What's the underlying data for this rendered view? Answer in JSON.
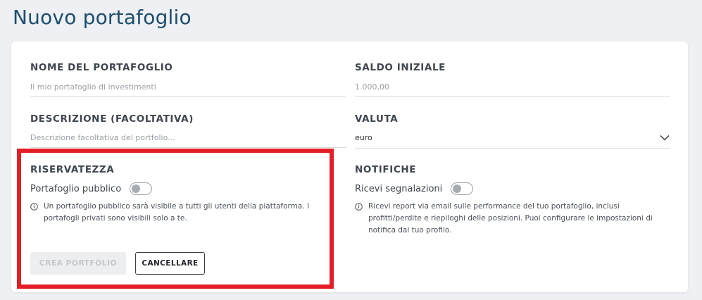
{
  "page": {
    "title": "Nuovo portafoglio"
  },
  "form": {
    "name": {
      "label": "NOME DEL PORTAFOGLIO",
      "placeholder": "Il mio portafoglio di investimenti"
    },
    "balance": {
      "label": "SALDO INIZIALE",
      "placeholder": "1.000,00"
    },
    "description": {
      "label": "DESCRIZIONE (FACOLTATIVA)",
      "placeholder": "Descrizione facoltativa del portfolio..."
    },
    "currency": {
      "label": "VALUTA",
      "value": "euro",
      "icon": "chevron-down-icon"
    },
    "privacy": {
      "label": "RISERVATEZZA",
      "toggle_label": "Portafoglio pubblico",
      "toggle_on": false,
      "help": "Un portafoglio pubblico sarà visibile a tutti gli utenti della piattaforma. I portafogli privati sono visibili solo a te."
    },
    "notifications": {
      "label": "NOTIFICHE",
      "toggle_label": "Ricevi segnalazioni",
      "toggle_on": false,
      "help": "Ricevi report via email sulle performance del tuo portafoglio, inclusi profitti/perdite e riepiloghi delle posizioni. Puoi configurare le impostazioni di notifica dal tuo profilo."
    },
    "actions": {
      "create_label": "CREA PORTFOLIO",
      "cancel_label": "CANCELLARE"
    }
  },
  "colors": {
    "title": "#1d4d6e",
    "highlight": "#e41e26",
    "background": "#eef0f3"
  }
}
